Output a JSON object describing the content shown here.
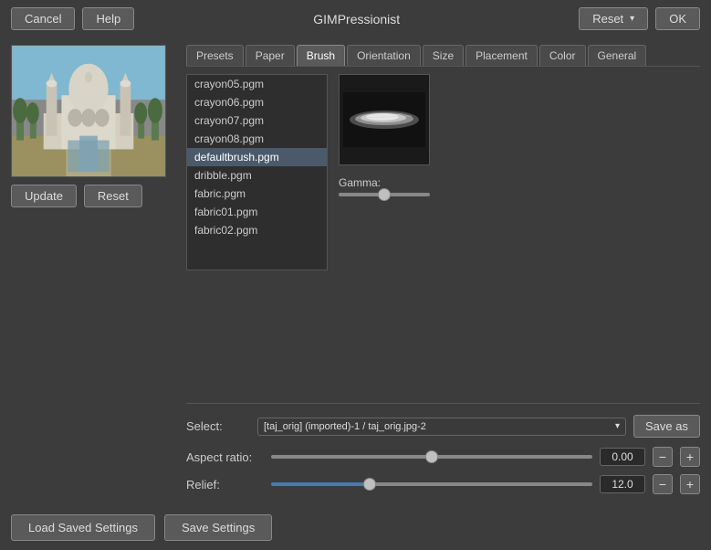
{
  "titleBar": {
    "title": "GIMPressionist",
    "cancelLabel": "Cancel",
    "helpLabel": "Help",
    "resetLabel": "Reset",
    "okLabel": "OK"
  },
  "tabs": {
    "items": [
      {
        "label": "Presets",
        "active": false
      },
      {
        "label": "Paper",
        "active": false
      },
      {
        "label": "Brush",
        "active": true
      },
      {
        "label": "Orientation",
        "active": false
      },
      {
        "label": "Size",
        "active": false
      },
      {
        "label": "Placement",
        "active": false
      },
      {
        "label": "Color",
        "active": false
      },
      {
        "label": "General",
        "active": false
      }
    ]
  },
  "brushList": {
    "items": [
      {
        "label": "crayon05.pgm",
        "selected": false
      },
      {
        "label": "crayon06.pgm",
        "selected": false
      },
      {
        "label": "crayon07.pgm",
        "selected": false
      },
      {
        "label": "crayon08.pgm",
        "selected": false
      },
      {
        "label": "defaultbrush.pgm",
        "selected": true
      },
      {
        "label": "dribble.pgm",
        "selected": false
      },
      {
        "label": "fabric.pgm",
        "selected": false
      },
      {
        "label": "fabric01.pgm",
        "selected": false
      },
      {
        "label": "fabric02.pgm",
        "selected": false
      }
    ]
  },
  "gamma": {
    "label": "Gamma:",
    "value": 0.5
  },
  "selectRow": {
    "label": "Select:",
    "value": "[taj_orig] (imported)-1 / taj_orig.jpg-2",
    "saveAsLabel": "Save as"
  },
  "aspectRatio": {
    "label": "Aspect ratio:",
    "value": "0.00",
    "sliderValue": 50
  },
  "relief": {
    "label": "Relief:",
    "value": "12.0",
    "sliderValue": 30
  },
  "bottomBar": {
    "loadLabel": "Load Saved Settings",
    "saveLabel": "Save Settings"
  },
  "leftButtons": {
    "updateLabel": "Update",
    "resetLabel": "Reset"
  }
}
